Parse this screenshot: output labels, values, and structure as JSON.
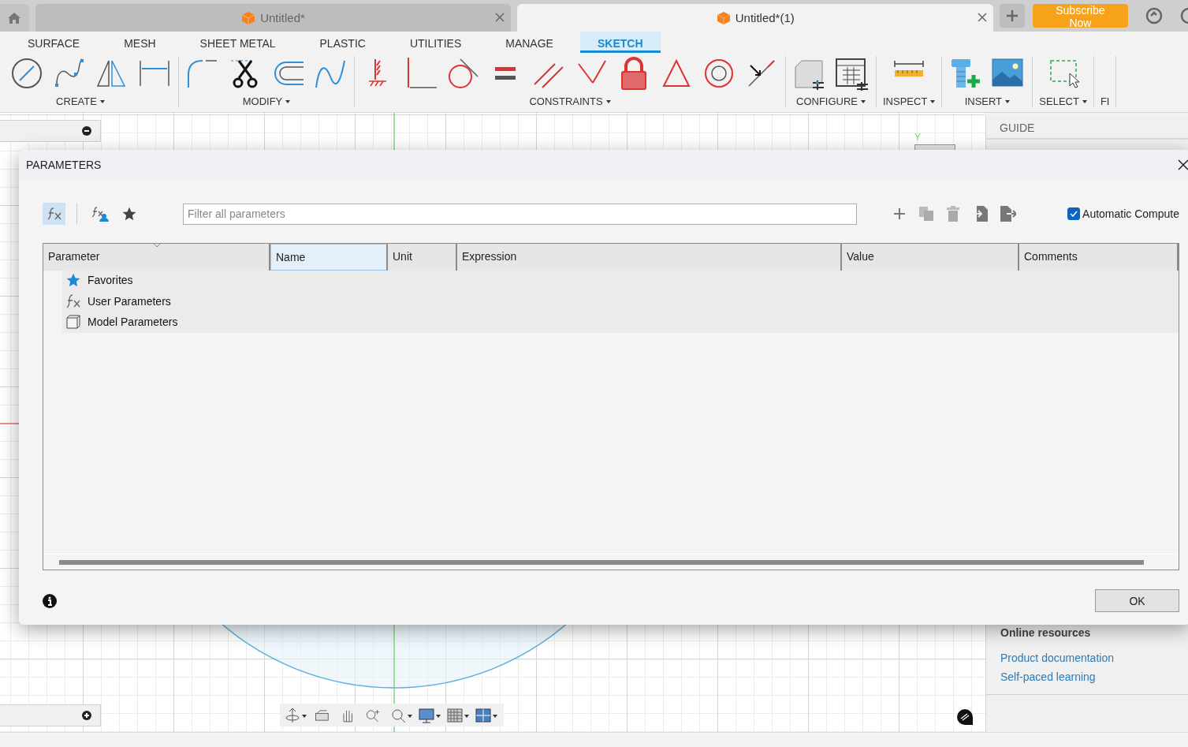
{
  "document_tabs": [
    {
      "title": "Untitled*",
      "selected": false
    },
    {
      "title": "Untitled*(1)",
      "selected": true
    }
  ],
  "subscribe_button": "Subscribe Now",
  "workspace_tabs": [
    {
      "label": "SURFACE",
      "selected": false
    },
    {
      "label": "MESH",
      "selected": false
    },
    {
      "label": "SHEET METAL",
      "selected": false
    },
    {
      "label": "PLASTIC",
      "selected": false
    },
    {
      "label": "UTILITIES",
      "selected": false
    },
    {
      "label": "MANAGE",
      "selected": false
    },
    {
      "label": "SKETCH",
      "selected": true
    }
  ],
  "tool_groups": [
    {
      "label": "CREATE"
    },
    {
      "label": "MODIFY"
    },
    {
      "label": "CONSTRAINTS"
    },
    {
      "label": "CONFIGURE"
    },
    {
      "label": "INSPECT"
    },
    {
      "label": "INSERT"
    },
    {
      "label": "SELECT"
    },
    {
      "label": "FI"
    }
  ],
  "canvas": {
    "axis_label": "Y"
  },
  "guide_panel": {
    "title": "GUIDE",
    "section_title": "Online resources",
    "links": [
      "Product documentation",
      "Self-paced learning"
    ]
  },
  "dialog": {
    "title": "PARAMETERS",
    "view_buttons": [
      {
        "kind": "all",
        "selected": true
      },
      {
        "kind": "user",
        "selected": false
      },
      {
        "kind": "favorites",
        "selected": false
      }
    ],
    "filter_placeholder": "Filter all parameters",
    "automatic_compute": {
      "label": "Automatic Compute",
      "checked": true
    },
    "columns": [
      {
        "label": "Parameter",
        "selected": false
      },
      {
        "label": "Name",
        "selected": true
      },
      {
        "label": "Unit",
        "selected": false
      },
      {
        "label": "Expression",
        "selected": false
      },
      {
        "label": "Value",
        "selected": false
      },
      {
        "label": "Comments",
        "selected": false
      }
    ],
    "rows": [
      {
        "kind": "favorites",
        "label": "Favorites"
      },
      {
        "kind": "user",
        "label": "User Parameters"
      },
      {
        "kind": "model",
        "label": "Model Parameters"
      }
    ],
    "ok_button": "OK"
  }
}
